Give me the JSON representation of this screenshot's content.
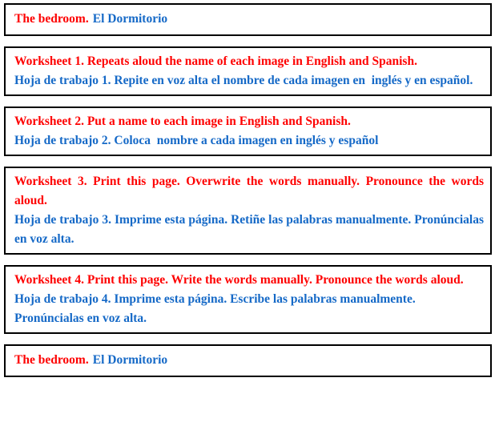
{
  "document": {
    "title": "The bedroom. El Dormitorio",
    "colors": {
      "english": "#fe0000",
      "spanish": "#1569c7",
      "border": "#000000",
      "background": "#ffffff"
    }
  },
  "panels": [
    {
      "id": "header-title",
      "type": "title",
      "english": "The bedroom.",
      "spanish": "El Dormitorio"
    },
    {
      "id": "worksheet-1",
      "type": "worksheet",
      "number": "1",
      "english": "Worksheet 1. Repeats aloud the name of each image in English and Spanish.",
      "spanish": "Hoja de trabajo 1. Repite en voz alta el nombre de cada imagen en  inglés y en español.",
      "english_align": "justify",
      "spanish_align": "justify"
    },
    {
      "id": "worksheet-2",
      "type": "worksheet",
      "number": "2",
      "english": "Worksheet 2. Put a name to each image in English and Spanish.",
      "spanish": "Hoja de trabajo 2. Coloca  nombre a cada imagen en inglés y español",
      "english_align": "left",
      "spanish_align": "left"
    },
    {
      "id": "worksheet-3",
      "type": "worksheet",
      "number": "3",
      "english": "Worksheet 3. Print this page. Overwrite the words manually. Pronounce the words aloud.",
      "spanish": "Hoja de trabajo 3. Imprime esta página. Retiñe las palabras manualmente. Pronúncialas en voz alta.",
      "english_align": "justify",
      "spanish_align": "justify"
    },
    {
      "id": "worksheet-4",
      "type": "worksheet",
      "number": "4",
      "english": "Worksheet 4. Print this page. Write the words manually. Pronounce the words aloud.",
      "spanish": "Hoja de trabajo 4. Imprime esta página. Escribe las palabras manualmente. Pronúncialas en voz alta.",
      "english_align": "justify",
      "spanish_align": "left"
    },
    {
      "id": "footer-title",
      "type": "title",
      "english": "The bedroom.",
      "spanish": "El Dormitorio"
    }
  ]
}
